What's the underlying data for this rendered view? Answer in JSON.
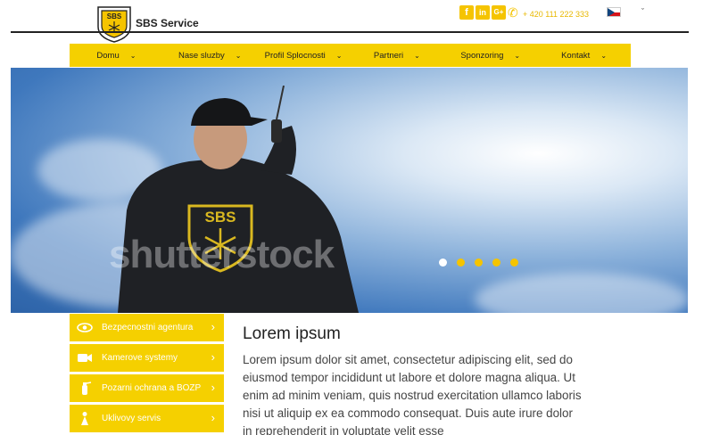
{
  "header": {
    "brand": "SBS Service",
    "logo_text": "SBS",
    "social": [
      {
        "name": "facebook-icon",
        "glyph": "f"
      },
      {
        "name": "linkedin-icon",
        "glyph": "in"
      },
      {
        "name": "google-plus-icon",
        "glyph": "G+"
      }
    ],
    "phone": "+ 420 111 222 333",
    "language": {
      "flag": "cz-flag-icon",
      "caret": "ˇ"
    }
  },
  "nav": {
    "items": [
      {
        "label": "Domu"
      },
      {
        "label": "Nase sluzby"
      },
      {
        "label": "Profil Splocnosti"
      },
      {
        "label": "Partneri"
      },
      {
        "label": "Sponzoring"
      },
      {
        "label": "Kontakt"
      }
    ]
  },
  "hero": {
    "watermark": "shutterstock",
    "badge_text": "SBS",
    "slides": 5,
    "active_slide": 0
  },
  "sidebar": {
    "items": [
      {
        "label": "Bezpecnostni agentura",
        "icon": "eye-icon"
      },
      {
        "label": "Kamerove systemy",
        "icon": "camera-icon"
      },
      {
        "label": "Pozarni ochrana a BOZP",
        "icon": "fire-extinguisher-icon"
      },
      {
        "label": "Uklivovy servis",
        "icon": "cleaning-person-icon"
      }
    ]
  },
  "content": {
    "title": "Lorem ipsum",
    "body": "Lorem ipsum dolor sit amet, consectetur adipiscing elit, sed do eiusmod tempor incididunt ut labore et dolore magna aliqua. Ut enim ad minim veniam, quis nostrud exercitation ullamco laboris nisi ut aliquip ex ea commodo consequat. Duis aute irure dolor in reprehenderit in voluptate velit esse"
  },
  "colors": {
    "accent": "#f5d000",
    "sky": "#3f78bd"
  }
}
